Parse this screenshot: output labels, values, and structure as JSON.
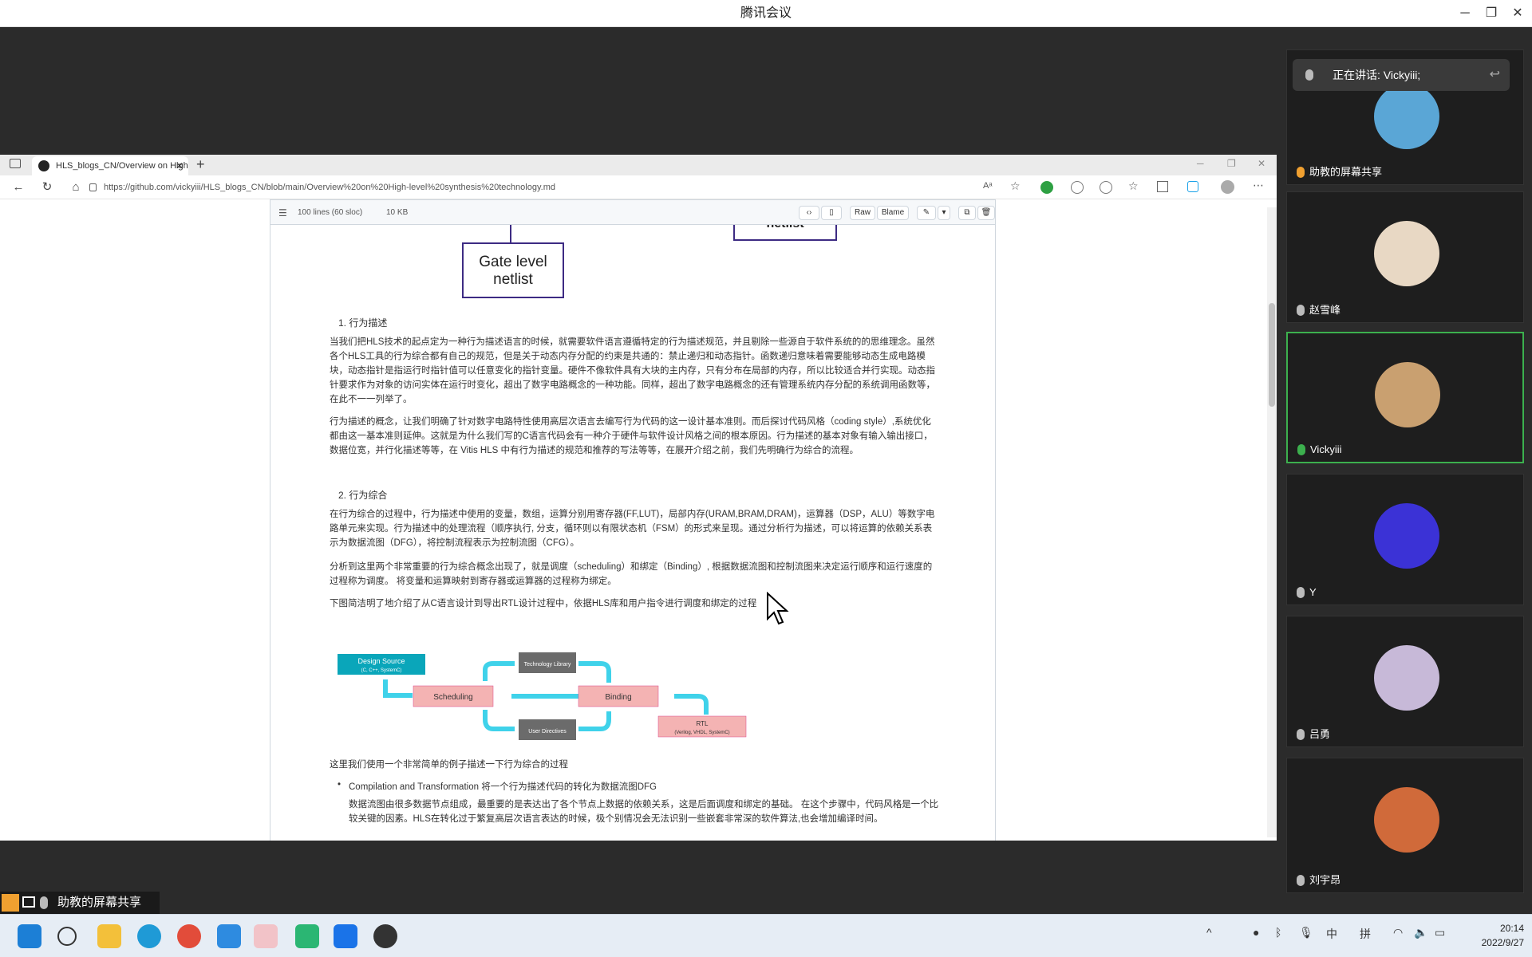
{
  "window": {
    "title": "腾讯会议"
  },
  "browser": {
    "tab_title": "HLS_blogs_CN/Overview on High-level synthesis technology.md",
    "url": "https://github.com/vickyiii/HLS_blogs_CN/blob/main/Overview%20on%20High-level%20synthesis%20technology.md"
  },
  "file": {
    "lines": "100 lines (60 sloc)",
    "size": "10 KB",
    "raw": "Raw",
    "blame": "Blame"
  },
  "article": {
    "partial_box": "netlist",
    "box_label": "Gate level netlist",
    "h1": "1. 行为描述",
    "p1": "当我们把HLS技术的起点定为一种行为描述语言的时候，就需要软件语言遵循特定的行为描述规范，并且剔除一些源自于软件系统的的思维理念。虽然各个HLS工具的行为综合都有自己的规范，但是关于动态内存分配的约束是共通的：禁止递归和动态指针。函数递归意味着需要能够动态生成电路模块，动态指针是指运行时指针值可以任意变化的指针变量。硬件不像软件具有大块的主内存，只有分布在局部的内存，所以比较适合并行实现。动态指针要求作为对象的访问实体在运行时变化，超出了数字电路概念的一种功能。同样，超出了数字电路概念的还有管理系统内存分配的系统调用函数等，在此不一一列举了。",
    "p2": "行为描述的概念，让我们明确了针对数字电路特性使用高层次语言去编写行为代码的这一设计基本准则。而后探讨代码风格（coding style）,系统优化都由这一基本准则延伸。这就是为什么我们写的C语言代码会有一种介于硬件与软件设计风格之间的根本原因。行为描述的基本对象有输入输出接口，数据位宽，并行化描述等等，在 Vitis HLS 中有行为描述的规范和推荐的写法等等，在展开介绍之前，我们先明确行为综合的流程。",
    "h2": "2. 行为综合",
    "p3": "在行为综合的过程中，行为描述中使用的变量，数组，运算分别用寄存器(FF,LUT)，局部内存(URAM,BRAM,DRAM)，运算器（DSP，ALU）等数字电路单元来实现。行为描述中的处理流程（顺序执行, 分支，循环则以有限状态机（FSM）的形式来呈现。通过分析行为描述，可以将运算的依赖关系表示为数据流图（DFG），将控制流程表示为控制流图（CFG）。",
    "p4": "分析到这里两个非常重要的行为综合概念出现了，就是调度（scheduling）和绑定（Binding）, 根据数据流图和控制流图来决定运行顺序和运行速度的过程称为调度。 将变量和运算映射到寄存器或运算器的过程称为绑定。",
    "p5": "下图简洁明了地介绍了从C语言设计到导出RTL设计过程中，依据HLS库和用户指令进行调度和绑定的过程",
    "p6": "这里我们使用一个非常简单的例子描述一下行为综合的过程",
    "bullet": "Compilation and Transformation 将一个行为描述代码的转化为数据流图DFG",
    "p7": "数据流图由很多数据节点组成，最重要的是表达出了各个节点上数据的依赖关系，这是后面调度和绑定的基础。 在这个步骤中，代码风格是一个比较关键的因素。HLS在转化过于繁复高层次语言表达的时候，极个别情况会无法识别一些嵌套非常深的软件算法,也会增加编译时间。"
  },
  "diagram": {
    "design_source": "Design Source",
    "design_source_sub": "(C, C++, SystemC)",
    "tech_lib": "Technology Library",
    "scheduling": "Scheduling",
    "binding": "Binding",
    "user_dir": "User Directives",
    "rtl": "RTL",
    "rtl_sub": "(Verilog, VHDL, SystemC)"
  },
  "meeting": {
    "speaking": "正在讲话: Vickyiii;",
    "participants": [
      {
        "name": "助教的屏幕共享",
        "color": "#5aa6d6"
      },
      {
        "name": "赵雪峰",
        "color": "#e8d8c4"
      },
      {
        "name": "Vickyiii",
        "color": "#c9a070"
      },
      {
        "name": "Y",
        "color": "#3b32d6"
      },
      {
        "name": "吕勇",
        "color": "#c7b9d8"
      },
      {
        "name": "刘宇昂",
        "color": "#d06a3a"
      }
    ],
    "bottom_label": "助教的屏幕共享"
  },
  "taskbar": {
    "ime1": "中",
    "ime2": "拼",
    "time": "20:14",
    "date": "2022/9/27"
  }
}
